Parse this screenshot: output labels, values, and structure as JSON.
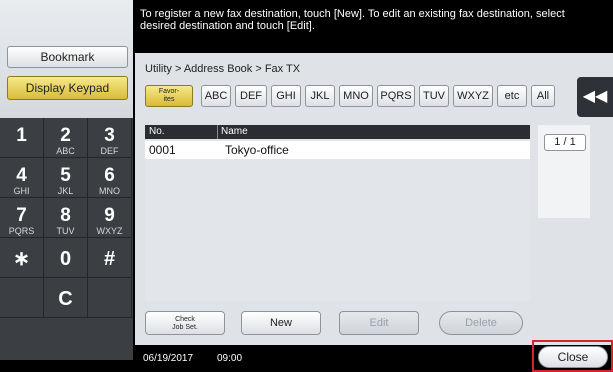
{
  "message": "To register a new fax destination, touch [New]. To edit an existing fax destination, select desired destination and touch [Edit].",
  "left": {
    "bookmark_label": "Bookmark",
    "display_keypad_label": "Display Keypad",
    "keys": [
      {
        "digit": "1",
        "letters": ""
      },
      {
        "digit": "2",
        "letters": "ABC"
      },
      {
        "digit": "3",
        "letters": "DEF"
      },
      {
        "digit": "4",
        "letters": "GHI"
      },
      {
        "digit": "5",
        "letters": "JKL"
      },
      {
        "digit": "6",
        "letters": "MNO"
      },
      {
        "digit": "7",
        "letters": "PQRS"
      },
      {
        "digit": "8",
        "letters": "TUV"
      },
      {
        "digit": "9",
        "letters": "WXYZ"
      },
      {
        "digit": "∗",
        "letters": ""
      },
      {
        "digit": "0",
        "letters": ""
      },
      {
        "digit": "#",
        "letters": ""
      },
      {
        "digit": "",
        "letters": ""
      },
      {
        "digit": "C",
        "letters": ""
      },
      {
        "digit": "",
        "letters": ""
      }
    ]
  },
  "breadcrumb": "Utility > Address Book > Fax TX",
  "index_tabs": {
    "favorites": "Favor-\nites",
    "tabs": [
      "ABC",
      "DEF",
      "GHI",
      "JKL",
      "MNO",
      "PQRS",
      "TUV",
      "WXYZ",
      "etc",
      "All"
    ]
  },
  "back_icon": "double-chevron-left-icon",
  "list": {
    "columns": [
      "No.",
      "Name"
    ],
    "rows": [
      {
        "no": "0001",
        "name": "Tokyo-office"
      }
    ]
  },
  "pager": {
    "text": "1  /  1"
  },
  "actions": {
    "check_job_set": "Check\nJob Set.",
    "new": "New",
    "edit": "Edit",
    "delete": "Delete"
  },
  "status": {
    "date": "06/19/2017",
    "time": "09:00"
  },
  "close_label": "Close",
  "colors": {
    "highlight_border": "#d9222a",
    "selected_tab": "#e6cf5a",
    "header_bg": "#2a2d31"
  }
}
